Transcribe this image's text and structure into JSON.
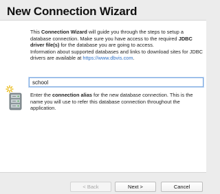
{
  "wizard": {
    "title": "New Connection Wizard"
  },
  "intro": {
    "t1": "This ",
    "b1": "Connection Wizard",
    "t2": " will guide you through the steps to setup a database connection. Make sure you have access to the required ",
    "b2": "JDBC driver file(s)",
    "t3": " for the database you are going to access.",
    "t4": "Information about supported databases and links to download sites for JDBC drivers are available at ",
    "link": "https://www.dbvis.com",
    "t5": "."
  },
  "alias": {
    "value": "school",
    "desc_t1": "Enter the ",
    "desc_b1": "connection alias",
    "desc_t2": " for the new database connection. This is the name you will use to refer this database connection throughout the application."
  },
  "icons": {
    "wizard_icon": "database-server-icon"
  },
  "buttons": {
    "back": "< Back",
    "next": "Next >",
    "cancel": "Cancel"
  },
  "colors": {
    "link": "#2d6fc4",
    "focus_border": "#7aa7e0",
    "icon_spark": "#e8b400"
  }
}
